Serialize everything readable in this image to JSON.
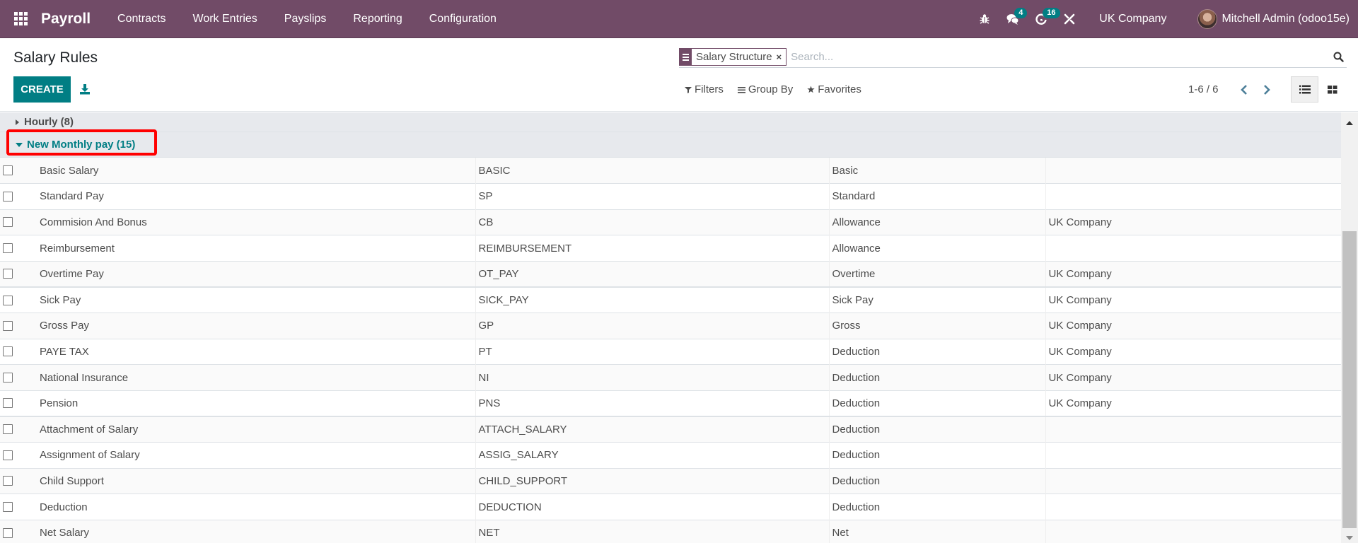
{
  "navbar": {
    "app_name": "Payroll",
    "menu": [
      "Contracts",
      "Work Entries",
      "Payslips",
      "Reporting",
      "Configuration"
    ],
    "icons": {
      "debug": "bug-icon",
      "messages": "chat-icon",
      "activities": "clock-icon",
      "tools": "tools-icon"
    },
    "messages_count": "4",
    "activities_count": "16",
    "company": "UK Company",
    "user": "Mitchell Admin (odoo15e)"
  },
  "control_panel": {
    "title": "Salary Rules",
    "create_label": "CREATE",
    "search": {
      "facet_label": "Salary Structure",
      "facet_close": "×",
      "placeholder": "Search..."
    },
    "filters_label": "Filters",
    "group_by_label": "Group By",
    "favorites_label": "Favorites",
    "pager": "1-6 / 6"
  },
  "groups": {
    "collapsed": {
      "label": "Hourly (8)"
    },
    "expanded": {
      "label": "New Monthly pay (15)"
    }
  },
  "rows": [
    {
      "name": "Basic Salary",
      "code": "BASIC",
      "category": "Basic",
      "company": ""
    },
    {
      "name": "Standard Pay",
      "code": "SP",
      "category": "Standard",
      "company": ""
    },
    {
      "name": "Commision And Bonus",
      "code": "CB",
      "category": "Allowance",
      "company": "UK Company"
    },
    {
      "name": "Reimbursement",
      "code": "REIMBURSEMENT",
      "category": "Allowance",
      "company": ""
    },
    {
      "name": "Overtime Pay",
      "code": "OT_PAY",
      "category": "Overtime",
      "company": "UK Company"
    },
    {
      "name": "Sick Pay",
      "code": "SICK_PAY",
      "category": "Sick Pay",
      "company": "UK Company"
    },
    {
      "name": "Gross Pay",
      "code": "GP",
      "category": "Gross",
      "company": "UK Company"
    },
    {
      "name": "PAYE TAX",
      "code": "PT",
      "category": "Deduction",
      "company": "UK Company"
    },
    {
      "name": "National Insurance",
      "code": "NI",
      "category": "Deduction",
      "company": "UK Company"
    },
    {
      "name": "Pension",
      "code": "PNS",
      "category": "Deduction",
      "company": "UK Company"
    },
    {
      "name": "Attachment of Salary",
      "code": "ATTACH_SALARY",
      "category": "Deduction",
      "company": ""
    },
    {
      "name": "Assignment of Salary",
      "code": "ASSIG_SALARY",
      "category": "Deduction",
      "company": ""
    },
    {
      "name": "Child Support",
      "code": "CHILD_SUPPORT",
      "category": "Deduction",
      "company": ""
    },
    {
      "name": "Deduction",
      "code": "DEDUCTION",
      "category": "Deduction",
      "company": ""
    },
    {
      "name": "Net Salary",
      "code": "NET",
      "category": "Net",
      "company": ""
    }
  ],
  "colors": {
    "brand": "#714b67",
    "accent": "#017e84",
    "highlight": "#ff0000"
  }
}
